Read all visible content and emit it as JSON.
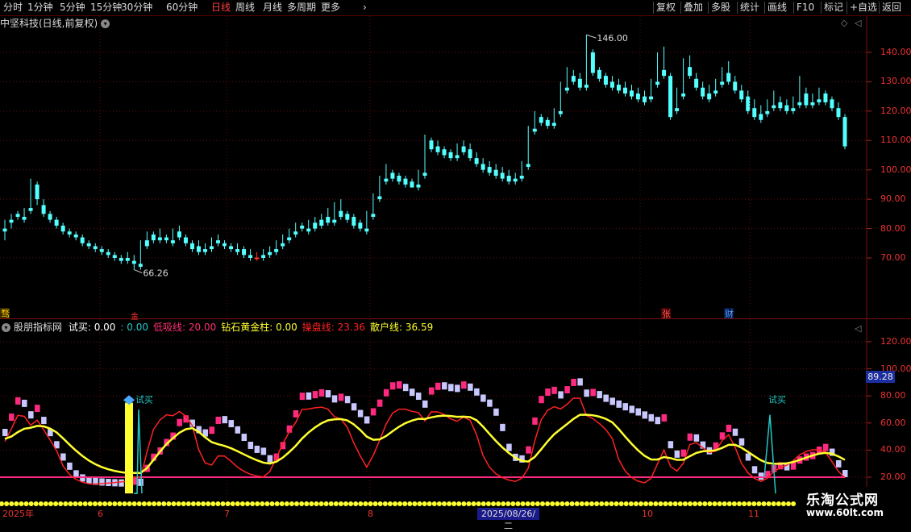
{
  "toolbar": {
    "periods": [
      "分时",
      "1分钟",
      "5分钟",
      "15分钟",
      "30分钟",
      "60分钟",
      "日线",
      "周线",
      "月线",
      "多周期",
      "更多"
    ],
    "active_period": "日线",
    "right_buttons": [
      "复权",
      "叠加",
      "多股",
      "统计",
      "画线",
      "F10",
      "标记",
      "+自选",
      "返回"
    ]
  },
  "stock": {
    "title": "中坚科技(日线,前复权)",
    "high_label": "146.00",
    "low_label": "66.26"
  },
  "price_axis": [
    "140.00",
    "130.00",
    "120.00",
    "110.00",
    "100.00",
    "90.00",
    "80.00",
    "70.00"
  ],
  "indicator": {
    "name": "股朋指标网",
    "items": [
      {
        "label": "试买: 0.00",
        "color": "#ffffff"
      },
      {
        "label": ": 0.00",
        "color": "#22c8c8"
      },
      {
        "label": "低吸线: 20.00",
        "color": "#ff3070"
      },
      {
        "label": "钻石黄金柱: 0.00",
        "color": "#ffff30"
      },
      {
        "label": "操盘线: 23.36",
        "color": "#ff2222"
      },
      {
        "label": "散户线: 36.59",
        "color": "#ffff30"
      }
    ],
    "axis": [
      "120.00",
      "100.00",
      "80.00",
      "60.00",
      "40.00",
      "20.00"
    ],
    "cursor_value": "89.28",
    "signal_label": "试买"
  },
  "markers": {
    "left_tag": "骛",
    "zhang": "张",
    "cai": "财",
    "jin": "金"
  },
  "date_axis": [
    "2025年",
    "6",
    "7",
    "8",
    "10",
    "11"
  ],
  "cursor_date": "2025/08/26/二",
  "watermark": {
    "line1": "乐淘公式网",
    "line2": "www.60lt.com"
  },
  "colors": {
    "up": "#ff3333",
    "down": "#54ffff",
    "grid": "#7a1010",
    "yellow": "#ffff30",
    "pink": "#ff2a80",
    "lavender": "#c8c8ff"
  },
  "chart_data": {
    "type": "candlestick",
    "candles": [
      [
        80,
        83,
        79,
        76
      ],
      [
        83,
        85,
        82,
        80
      ],
      [
        85,
        86,
        84,
        83
      ],
      [
        84,
        87,
        83,
        82
      ],
      [
        87,
        97,
        86,
        85
      ],
      [
        95,
        96,
        90,
        88
      ],
      [
        88,
        90,
        85,
        84
      ],
      [
        85,
        86,
        83,
        82
      ],
      [
        83,
        84,
        81,
        80
      ],
      [
        81,
        82,
        79,
        78
      ],
      [
        79,
        80,
        78,
        77
      ],
      [
        78,
        79,
        77,
        76
      ],
      [
        77,
        78,
        75,
        74
      ],
      [
        75,
        76,
        74,
        73
      ],
      [
        74,
        75,
        73,
        72
      ],
      [
        73,
        74,
        72,
        71
      ],
      [
        72,
        73,
        71,
        70
      ],
      [
        71,
        72,
        70,
        69
      ],
      [
        70,
        71,
        69,
        68
      ],
      [
        70,
        72,
        69,
        68
      ],
      [
        69,
        71,
        68,
        66
      ],
      [
        68,
        76,
        67,
        66
      ],
      [
        76,
        79,
        74,
        73
      ],
      [
        78,
        79,
        76,
        75
      ],
      [
        77,
        80,
        76,
        75
      ],
      [
        77,
        78,
        76,
        75
      ],
      [
        76,
        80,
        75,
        74
      ],
      [
        79,
        81,
        77,
        76
      ],
      [
        77,
        78,
        75,
        74
      ],
      [
        75,
        76,
        73,
        72
      ],
      [
        74,
        76,
        72,
        71
      ],
      [
        73,
        75,
        72,
        71
      ],
      [
        74,
        77,
        73,
        72
      ],
      [
        76,
        78,
        75,
        74
      ],
      [
        75,
        76,
        74,
        73
      ],
      [
        74,
        75,
        73,
        72
      ],
      [
        73,
        75,
        72,
        71
      ],
      [
        73,
        74,
        71,
        70
      ],
      [
        71,
        73,
        70,
        69
      ],
      [
        70,
        72,
        70,
        69
      ],
      [
        71,
        73,
        70,
        69
      ],
      [
        72,
        74,
        71,
        70
      ],
      [
        73,
        76,
        72,
        71
      ],
      [
        75,
        78,
        74,
        73
      ],
      [
        77,
        80,
        76,
        75
      ],
      [
        79,
        82,
        78,
        77
      ],
      [
        81,
        82,
        80,
        79
      ],
      [
        80,
        83,
        79,
        78
      ],
      [
        82,
        84,
        80,
        79
      ],
      [
        83,
        85,
        81,
        80
      ],
      [
        84,
        87,
        82,
        81
      ],
      [
        83,
        89,
        82,
        81
      ],
      [
        86,
        90,
        84,
        83
      ],
      [
        85,
        86,
        83,
        82
      ],
      [
        84,
        85,
        81,
        80
      ],
      [
        82,
        83,
        80,
        79
      ],
      [
        80,
        86,
        79,
        78
      ],
      [
        85,
        92,
        84,
        83
      ],
      [
        91,
        98,
        90,
        89
      ],
      [
        97,
        102,
        96,
        95
      ],
      [
        99,
        100,
        97,
        96
      ],
      [
        98,
        99,
        96,
        95
      ],
      [
        97,
        98,
        95,
        94
      ],
      [
        96,
        97,
        94,
        94
      ],
      [
        95,
        100,
        94,
        93
      ],
      [
        99,
        112,
        98,
        97
      ],
      [
        110,
        111,
        107,
        106
      ],
      [
        108,
        110,
        106,
        105
      ],
      [
        107,
        108,
        105,
        104
      ],
      [
        106,
        107,
        104,
        103
      ],
      [
        105,
        109,
        104,
        103
      ],
      [
        108,
        110,
        106,
        105
      ],
      [
        107,
        109,
        104,
        103
      ],
      [
        104,
        106,
        102,
        101
      ],
      [
        102,
        104,
        100,
        99
      ],
      [
        101,
        103,
        99,
        98
      ],
      [
        100,
        102,
        98,
        97
      ],
      [
        99,
        101,
        97,
        96
      ],
      [
        98,
        100,
        96,
        95
      ],
      [
        97,
        99,
        96,
        95
      ],
      [
        98,
        103,
        97,
        96
      ],
      [
        102,
        115,
        101,
        100
      ],
      [
        114,
        120,
        113,
        112
      ],
      [
        118,
        119,
        116,
        115
      ],
      [
        117,
        118,
        115,
        114
      ],
      [
        116,
        121,
        115,
        114
      ],
      [
        120,
        130,
        119,
        118
      ],
      [
        128,
        135,
        127,
        126
      ],
      [
        132,
        134,
        130,
        129
      ],
      [
        131,
        133,
        128,
        127
      ],
      [
        129,
        146,
        128,
        127
      ],
      [
        140,
        141,
        133,
        132
      ],
      [
        134,
        135,
        131,
        130
      ],
      [
        132,
        133,
        129,
        128
      ],
      [
        130,
        132,
        128,
        127
      ],
      [
        129,
        131,
        127,
        126
      ],
      [
        128,
        130,
        126,
        125
      ],
      [
        127,
        129,
        125,
        124
      ],
      [
        126,
        128,
        124,
        123
      ],
      [
        125,
        127,
        123,
        122
      ],
      [
        125,
        131,
        124,
        123
      ],
      [
        130,
        140,
        129,
        128
      ],
      [
        134,
        142,
        132,
        131
      ],
      [
        132,
        133,
        118,
        117
      ],
      [
        121,
        128,
        120,
        119
      ],
      [
        126,
        138,
        125,
        124
      ],
      [
        135,
        139,
        132,
        131
      ],
      [
        131,
        133,
        128,
        127
      ],
      [
        128,
        130,
        125,
        124
      ],
      [
        126,
        129,
        124,
        123
      ],
      [
        127,
        131,
        126,
        125
      ],
      [
        130,
        135,
        129,
        128
      ],
      [
        133,
        137,
        130,
        129
      ],
      [
        130,
        132,
        127,
        126
      ],
      [
        127,
        129,
        124,
        123
      ],
      [
        125,
        127,
        120,
        119
      ],
      [
        121,
        124,
        118,
        117
      ],
      [
        119,
        122,
        117,
        116
      ],
      [
        120,
        124,
        119,
        118
      ],
      [
        122,
        127,
        121,
        120
      ],
      [
        123,
        125,
        121,
        120
      ],
      [
        122,
        124,
        120,
        119
      ],
      [
        121,
        125,
        120,
        119
      ],
      [
        123,
        132,
        122,
        121
      ],
      [
        126,
        128,
        122,
        121
      ],
      [
        123,
        126,
        122,
        121
      ],
      [
        124,
        128,
        123,
        122
      ],
      [
        126,
        127,
        123,
        122
      ],
      [
        124,
        125,
        121,
        120
      ],
      [
        121,
        123,
        118,
        117
      ],
      [
        118,
        119,
        108,
        107
      ]
    ]
  }
}
